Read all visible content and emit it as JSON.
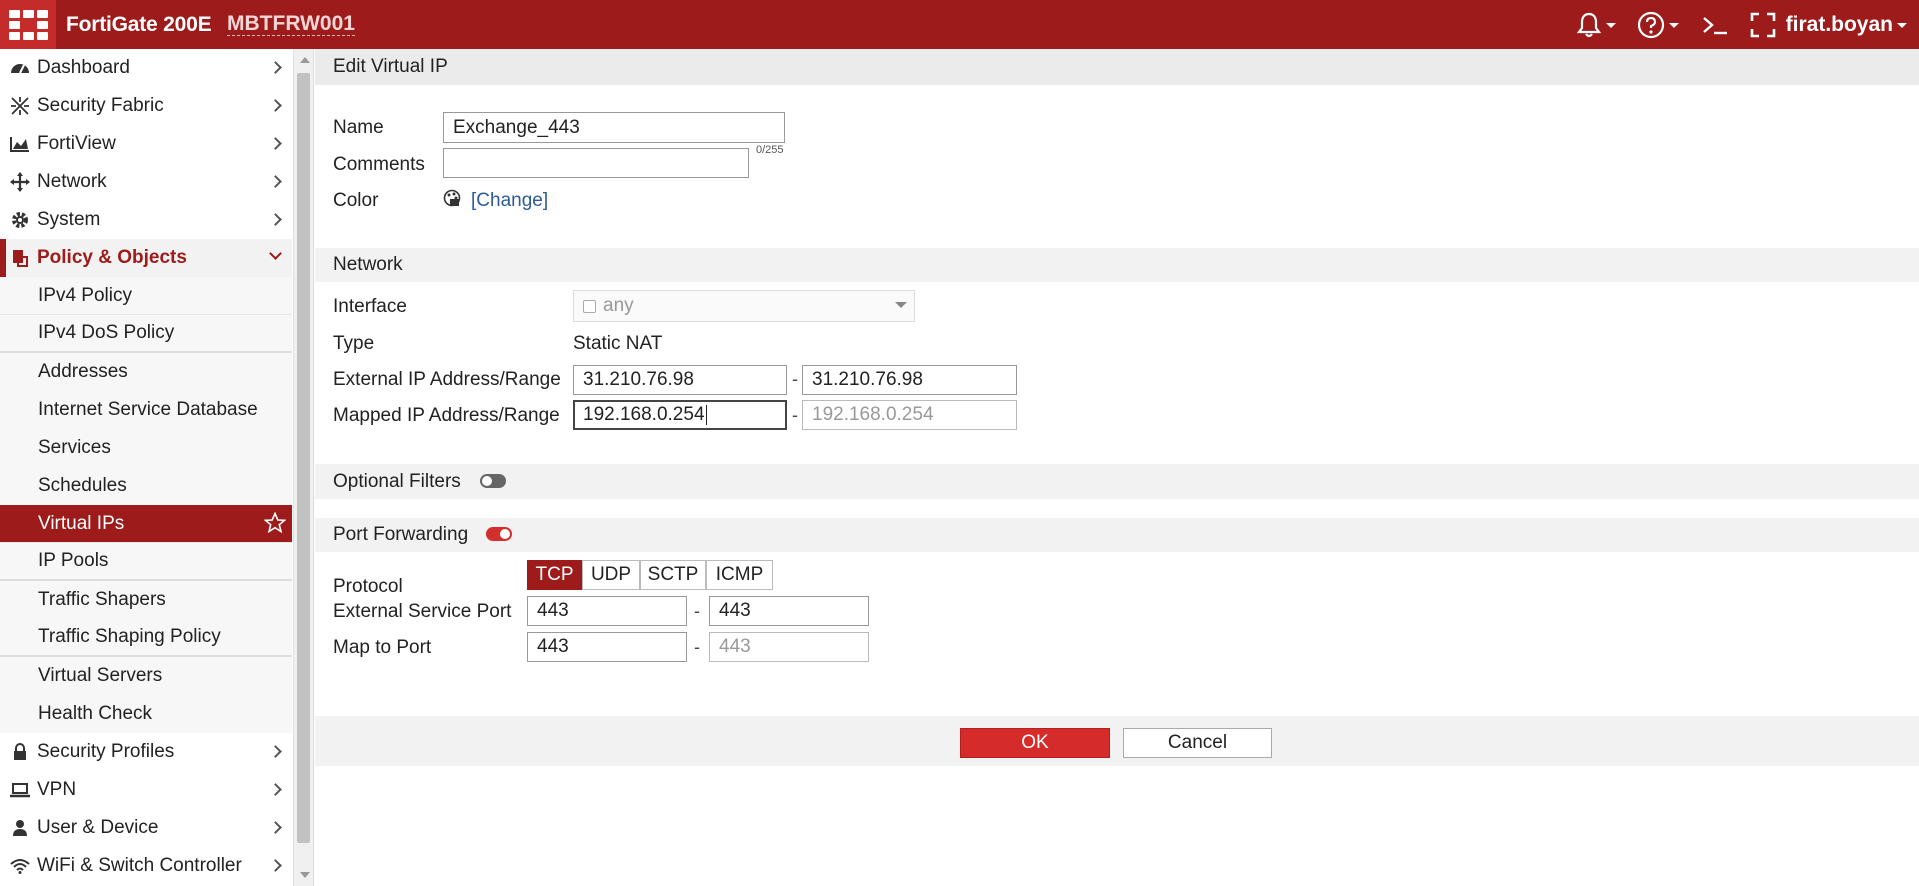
{
  "topbar": {
    "device": "FortiGate 200E",
    "hostname": "MBTFRW001",
    "user": "firat.boyan",
    "icons": [
      "bell-icon",
      "help-icon",
      "cli-console-icon",
      "fullscreen-icon"
    ]
  },
  "sidebar": {
    "items": [
      {
        "label": "Dashboard",
        "icon": "dashboard-icon"
      },
      {
        "label": "Security Fabric",
        "icon": "security-fabric-icon"
      },
      {
        "label": "FortiView",
        "icon": "fortiview-chart-icon"
      },
      {
        "label": "Network",
        "icon": "network-arrows-icon"
      },
      {
        "label": "System",
        "icon": "gear-icon"
      },
      {
        "label": "Policy & Objects",
        "icon": "policy-icon"
      }
    ],
    "sub_items": [
      "IPv4 Policy",
      "IPv4 DoS Policy",
      "Addresses",
      "Internet Service Database",
      "Services",
      "Schedules",
      "Virtual IPs",
      "IP Pools",
      "Traffic Shapers",
      "Traffic Shaping Policy",
      "Virtual Servers",
      "Health Check"
    ],
    "bottom_items": [
      {
        "label": "Security Profiles",
        "icon": "lock-icon"
      },
      {
        "label": "VPN",
        "icon": "laptop-icon"
      },
      {
        "label": "User & Device",
        "icon": "user-icon"
      },
      {
        "label": "WiFi & Switch Controller",
        "icon": "wifi-icon"
      }
    ]
  },
  "form": {
    "title": "Edit Virtual IP",
    "name_label": "Name",
    "name_value": "Exchange_443",
    "comments_label": "Comments",
    "comments_value": "",
    "comments_counter": "0/255",
    "color_label": "Color",
    "color_change": "[Change]",
    "network_header": "Network",
    "interface_label": "Interface",
    "interface_value": "any",
    "type_label": "Type",
    "type_value": "Static NAT",
    "ext_ip_label": "External IP Address/Range",
    "ext_ip_start": "31.210.76.98",
    "ext_ip_end": "31.210.76.98",
    "mapped_ip_label": "Mapped IP Address/Range",
    "mapped_ip_start": "192.168.0.254",
    "mapped_ip_end": "192.168.0.254",
    "range_separator": "-",
    "optional_filters_label": "Optional Filters",
    "optional_filters_enabled": false,
    "port_forwarding_label": "Port Forwarding",
    "port_forwarding_enabled": true,
    "protocol_label": "Protocol",
    "protocols": [
      "TCP",
      "UDP",
      "SCTP",
      "ICMP"
    ],
    "protocol_selected": "TCP",
    "ext_port_label": "External Service Port",
    "ext_port_start": "443",
    "ext_port_end": "443",
    "map_port_label": "Map to Port",
    "map_port_start": "443",
    "map_port_end": "443",
    "ok_label": "OK",
    "cancel_label": "Cancel"
  },
  "colors": {
    "brand": "#9d1b1b",
    "accent": "#d62b2b",
    "link": "#2d5b96"
  }
}
